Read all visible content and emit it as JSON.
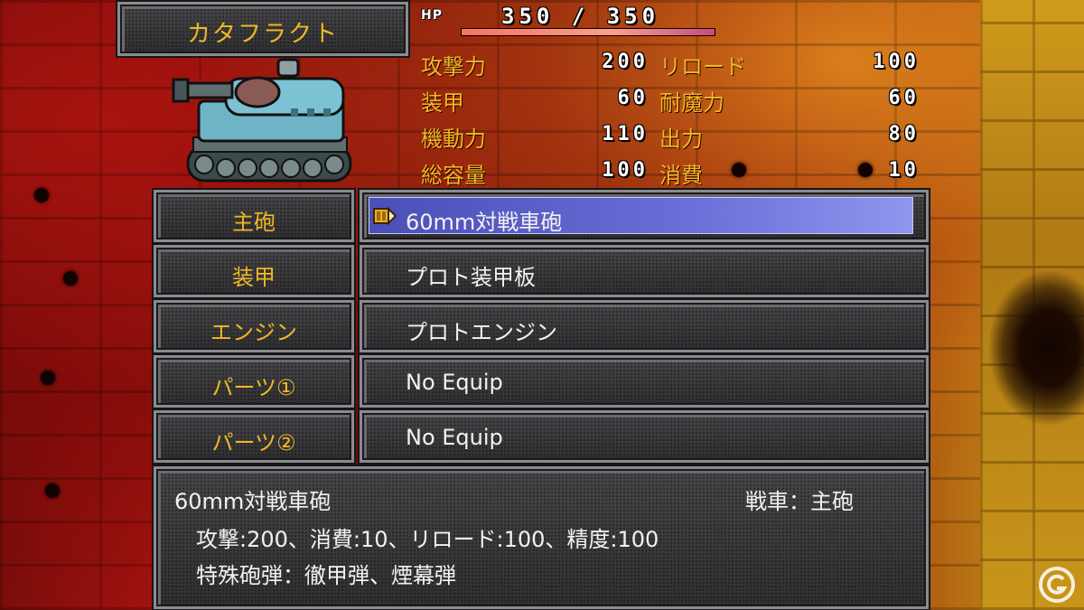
{
  "unit_name": "カタフラクト",
  "hp": {
    "label": "HP",
    "display": "350 /  350",
    "current": 350,
    "max": 350
  },
  "stats": [
    {
      "label": "攻撃力",
      "value": "200"
    },
    {
      "label": "リロード",
      "value": "100"
    },
    {
      "label": "装甲",
      "value": "60"
    },
    {
      "label": "耐魔力",
      "value": "60"
    },
    {
      "label": "機動力",
      "value": "110"
    },
    {
      "label": "出力",
      "value": "80"
    },
    {
      "label": "総容量",
      "value": "100"
    },
    {
      "label": "消費",
      "value": "10"
    }
  ],
  "equipment": [
    {
      "slot": "主砲",
      "item": "60mm対戦車砲",
      "selected": true
    },
    {
      "slot": "装甲",
      "item": "プロト装甲板",
      "selected": false
    },
    {
      "slot": "エンジン",
      "item": "プロトエンジン",
      "selected": false
    },
    {
      "slot": "パーツ①",
      "item": "No Equip",
      "selected": false
    },
    {
      "slot": "パーツ②",
      "item": "No Equip",
      "selected": false
    }
  ],
  "description": {
    "name": "60mm対戦車砲",
    "category": "戦車：主砲",
    "line1": "攻撃:200、消費:10、リロード:100、精度:100",
    "line2": "特殊砲弾：徹甲弾、煙幕弾"
  },
  "colors": {
    "label_gold": "#f0b824",
    "selection_blue": "#6a70d8",
    "hp_bar": "#ff8a78"
  },
  "icons": {
    "cursor": "ammo-cursor-icon",
    "watermark": "gamer-logo-icon",
    "tank": "tank-sprite"
  }
}
